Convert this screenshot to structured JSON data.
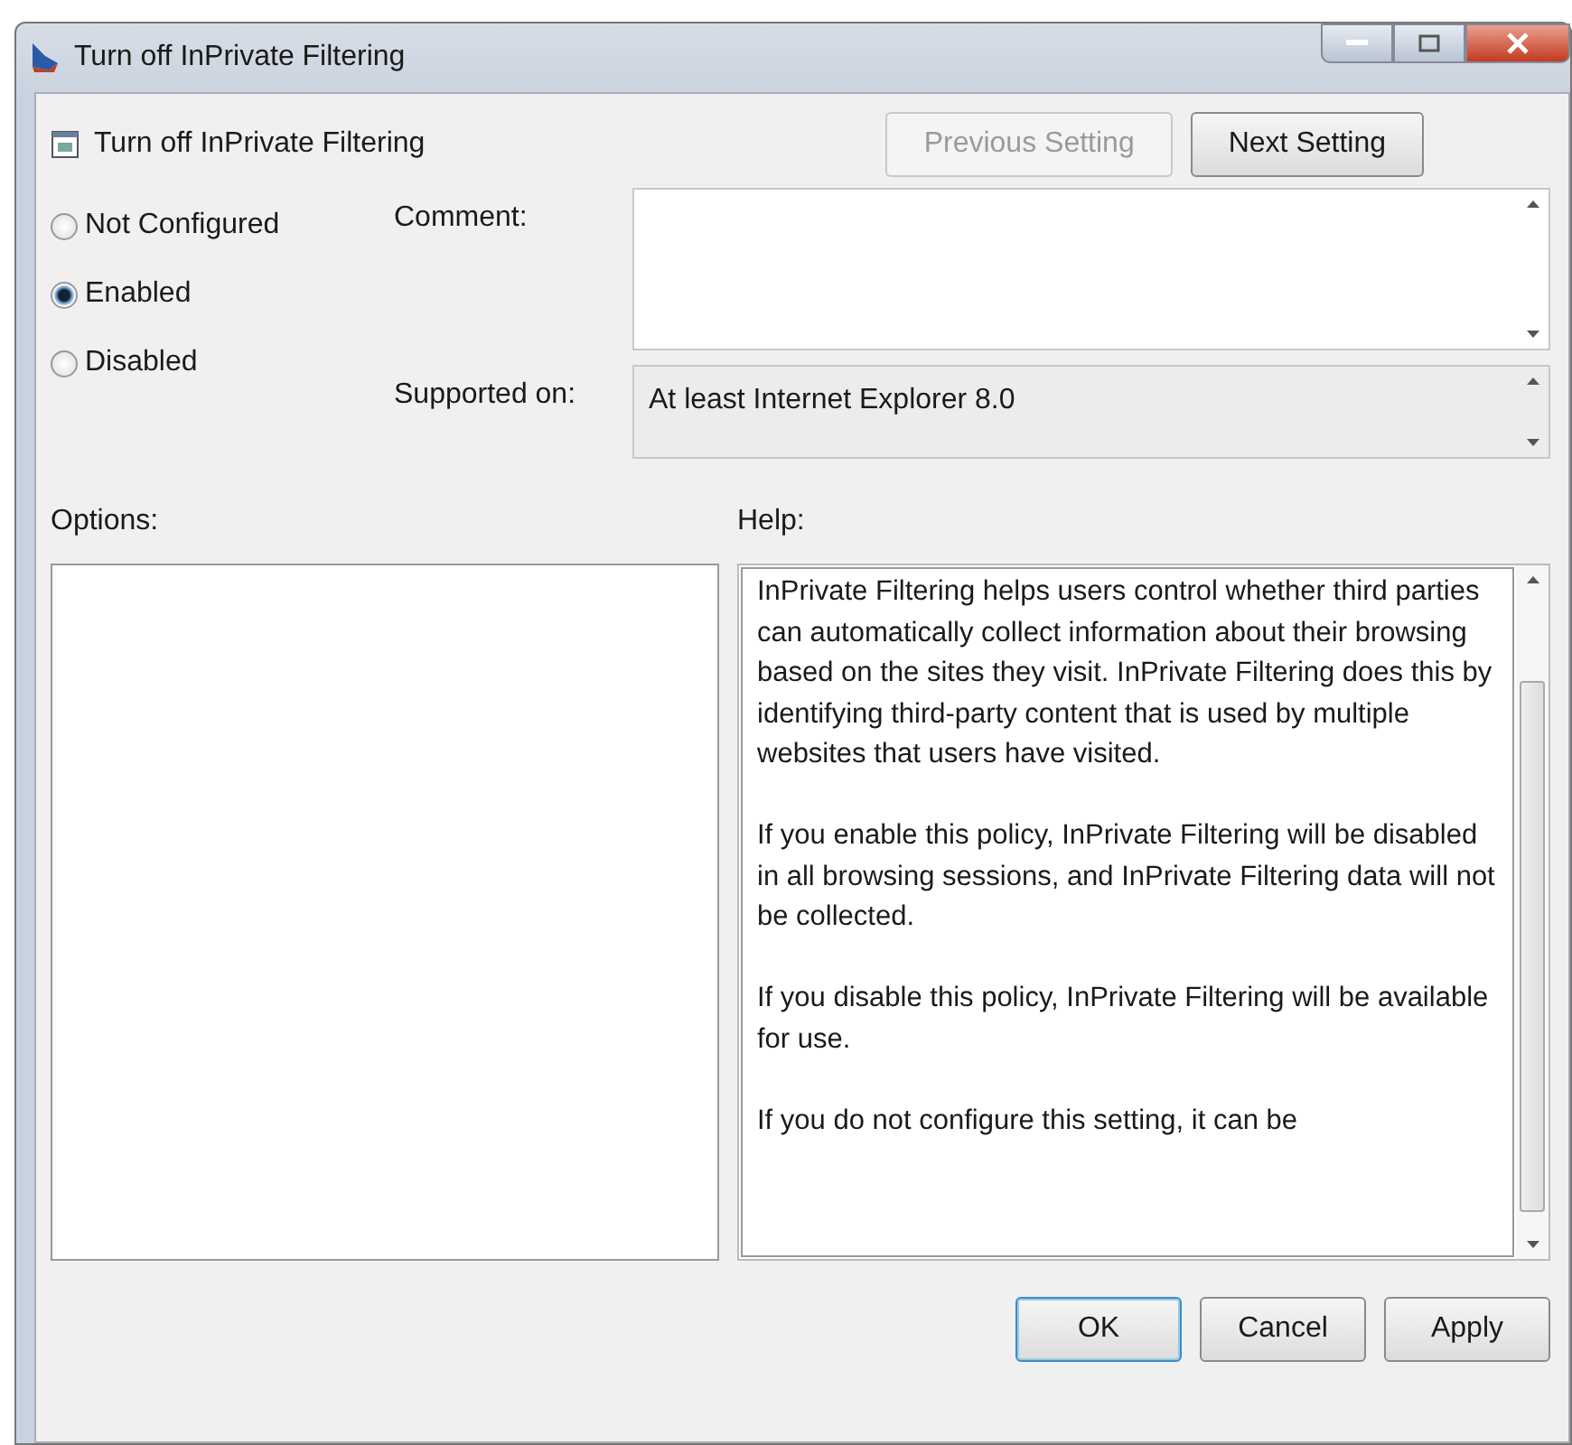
{
  "window": {
    "title": "Turn off InPrivate Filtering"
  },
  "setting": {
    "title": "Turn off InPrivate Filtering"
  },
  "nav_buttons": [
    {
      "label": "Previous Setting",
      "disabled": true
    },
    {
      "label": "Next Setting",
      "disabled": false
    }
  ],
  "state_options": [
    {
      "label": "Not Configured",
      "selected": false
    },
    {
      "label": "Enabled",
      "selected": true
    },
    {
      "label": "Disabled",
      "selected": false
    }
  ],
  "comment": {
    "label": "Comment:"
  },
  "supported_on": {
    "label": "Supported on:",
    "value": "At least Internet Explorer 8.0"
  },
  "options": {
    "label": "Options:"
  },
  "help": {
    "label": "Help:",
    "paragraphs": [
      "InPrivate Filtering helps users control whether third parties can automatically collect information about their browsing based on the sites they visit. InPrivate Filtering does this by identifying third-party content that is used by multiple websites that users have visited.",
      "If you enable this policy, InPrivate Filtering will be disabled in all browsing sessions, and InPrivate Filtering data will not be collected.",
      "If you disable this policy, InPrivate Filtering will be available for use.",
      "If you do not configure this setting, it can be"
    ]
  },
  "buttons": [
    {
      "label": "OK",
      "default": true
    },
    {
      "label": "Cancel",
      "default": false
    },
    {
      "label": "Apply",
      "default": false
    }
  ]
}
